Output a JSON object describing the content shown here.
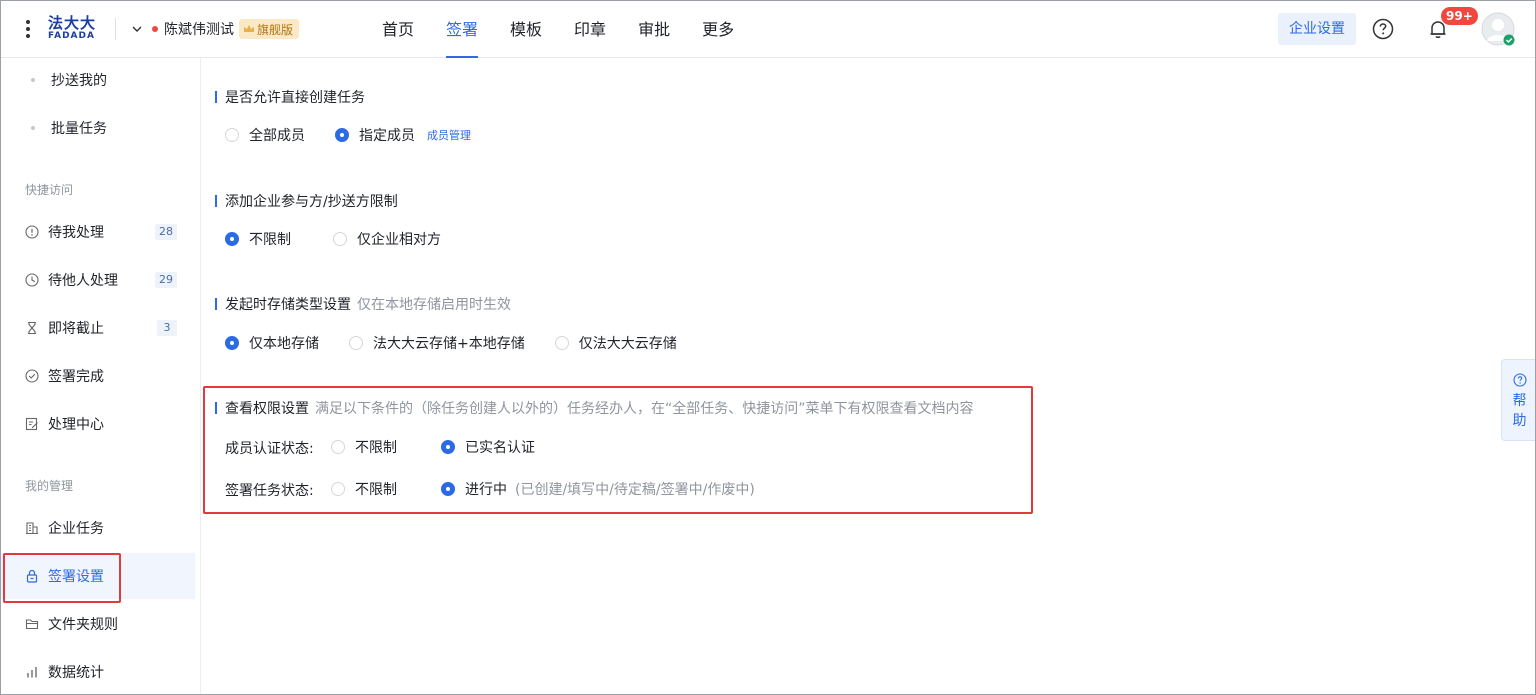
{
  "brand": {
    "logo_cn": "法大大",
    "logo_en": "FADADA"
  },
  "org": {
    "name": "陈斌伟测试",
    "plan": "旗舰版"
  },
  "nav": {
    "items": [
      "首页",
      "签署",
      "模板",
      "印章",
      "审批",
      "更多"
    ],
    "active": "签署"
  },
  "header": {
    "enterprise_settings": "企业设置",
    "notification_count": "99+"
  },
  "sidebar": {
    "sub_items": [
      "抄送我的",
      "批量任务"
    ],
    "quick_access_title": "快捷访问",
    "quick_access": [
      {
        "label": "待我处理",
        "count": "28",
        "icon": "alert-circle-icon"
      },
      {
        "label": "待他人处理",
        "count": "29",
        "icon": "clock-icon"
      },
      {
        "label": "即将截止",
        "count": "3",
        "icon": "hourglass-icon"
      },
      {
        "label": "签署完成",
        "icon": "check-circle-icon"
      },
      {
        "label": "处理中心",
        "icon": "edit-doc-icon"
      }
    ],
    "manage_title": "我的管理",
    "manage": [
      {
        "label": "企业任务",
        "icon": "building-icon"
      },
      {
        "label": "签署设置",
        "icon": "lock-icon",
        "active": true
      },
      {
        "label": "文件夹规则",
        "icon": "folder-icon"
      },
      {
        "label": "数据统计",
        "icon": "bar-chart-icon"
      }
    ]
  },
  "settings": {
    "create_task": {
      "title": "是否允许直接创建任务",
      "options": [
        "全部成员",
        "指定成员"
      ],
      "selected": "指定成员",
      "link": "成员管理"
    },
    "participant_limit": {
      "title": "添加企业参与方/抄送方限制",
      "options": [
        "不限制",
        "仅企业相对方"
      ],
      "selected": "不限制"
    },
    "storage": {
      "title": "发起时存储类型设置",
      "hint": "仅在本地存储启用时生效",
      "options": [
        "仅本地存储",
        "法大大云存储+本地存储",
        "仅法大大云存储"
      ],
      "selected": "仅本地存储"
    },
    "view_permission": {
      "title": "查看权限设置",
      "hint": "满足以下条件的（除任务创建人以外的）任务经办人，在“全部任务、快捷访问”菜单下有权限查看文档内容",
      "member_status_label": "成员认证状态:",
      "member_status_options": [
        "不限制",
        "已实名认证"
      ],
      "member_status_selected": "已实名认证",
      "task_status_label": "签署任务状态:",
      "task_status_options": [
        "不限制",
        "进行中"
      ],
      "task_status_selected": "进行中",
      "task_status_note": "(已创建/填写中/待定稿/签署中/作废中)"
    }
  },
  "help_float": {
    "label_1": "帮",
    "label_2": "助"
  },
  "colors": {
    "accent": "#2d6ae5",
    "highlight": "#e03a3a",
    "badge": "#f0483e"
  }
}
